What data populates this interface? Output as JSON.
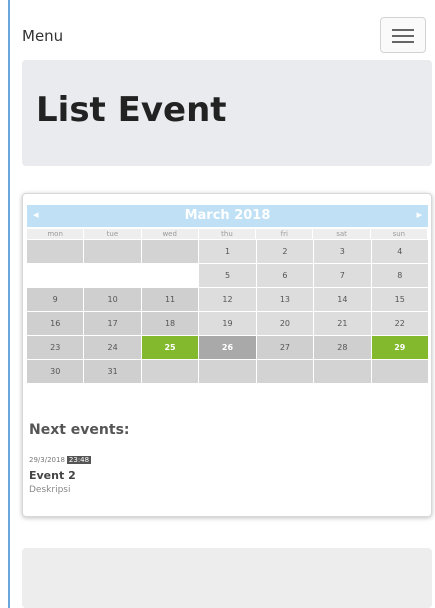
{
  "navbar": {
    "menu_label": "Menu",
    "toggle_icon": "hamburger-icon"
  },
  "page": {
    "title": "List Event"
  },
  "calendar": {
    "title": "March 2018",
    "prev_icon": "chevron-left-icon",
    "next_icon": "chevron-right-icon",
    "weekdays": [
      "mon",
      "tue",
      "wed",
      "thu",
      "fri",
      "sat",
      "sun"
    ],
    "cells": [
      {
        "day": "",
        "kind": "empty"
      },
      {
        "day": "",
        "kind": "empty"
      },
      {
        "day": "",
        "kind": "empty"
      },
      {
        "day": "1",
        "kind": "normal"
      },
      {
        "day": "2",
        "kind": "normal"
      },
      {
        "day": "3",
        "kind": "normal"
      },
      {
        "day": "4",
        "kind": "normal"
      },
      {
        "day": "",
        "kind": "blank"
      },
      {
        "day": "",
        "kind": "blank"
      },
      {
        "day": "",
        "kind": "blank"
      },
      {
        "day": "5",
        "kind": "normal"
      },
      {
        "day": "6",
        "kind": "normal"
      },
      {
        "day": "7",
        "kind": "normal"
      },
      {
        "day": "8",
        "kind": "normal"
      },
      {
        "day": "9",
        "kind": "past"
      },
      {
        "day": "10",
        "kind": "past"
      },
      {
        "day": "11",
        "kind": "past"
      },
      {
        "day": "12",
        "kind": "normal"
      },
      {
        "day": "13",
        "kind": "normal"
      },
      {
        "day": "14",
        "kind": "normal"
      },
      {
        "day": "15",
        "kind": "normal"
      },
      {
        "day": "16",
        "kind": "past"
      },
      {
        "day": "17",
        "kind": "past"
      },
      {
        "day": "18",
        "kind": "past"
      },
      {
        "day": "19",
        "kind": "normal"
      },
      {
        "day": "20",
        "kind": "normal"
      },
      {
        "day": "21",
        "kind": "normal"
      },
      {
        "day": "22",
        "kind": "normal"
      },
      {
        "day": "23",
        "kind": "past"
      },
      {
        "day": "24",
        "kind": "past"
      },
      {
        "day": "25",
        "kind": "event"
      },
      {
        "day": "26",
        "kind": "today"
      },
      {
        "day": "27",
        "kind": "past"
      },
      {
        "day": "28",
        "kind": "past"
      },
      {
        "day": "29",
        "kind": "event"
      },
      {
        "day": "30",
        "kind": "past"
      },
      {
        "day": "31",
        "kind": "past"
      },
      {
        "day": "",
        "kind": "filler"
      },
      {
        "day": "",
        "kind": "filler"
      },
      {
        "day": "",
        "kind": "filler"
      },
      {
        "day": "",
        "kind": "filler"
      },
      {
        "day": "",
        "kind": "filler"
      }
    ],
    "colors": {
      "header": "#bfe0f5",
      "event": "#82b92d",
      "today": "#a9a9a9"
    }
  },
  "next_events": {
    "label": "Next events:",
    "items": [
      {
        "date": "29/3/2018",
        "time": "23:48",
        "title": "Event 2",
        "description": "Deskripsi"
      }
    ]
  }
}
